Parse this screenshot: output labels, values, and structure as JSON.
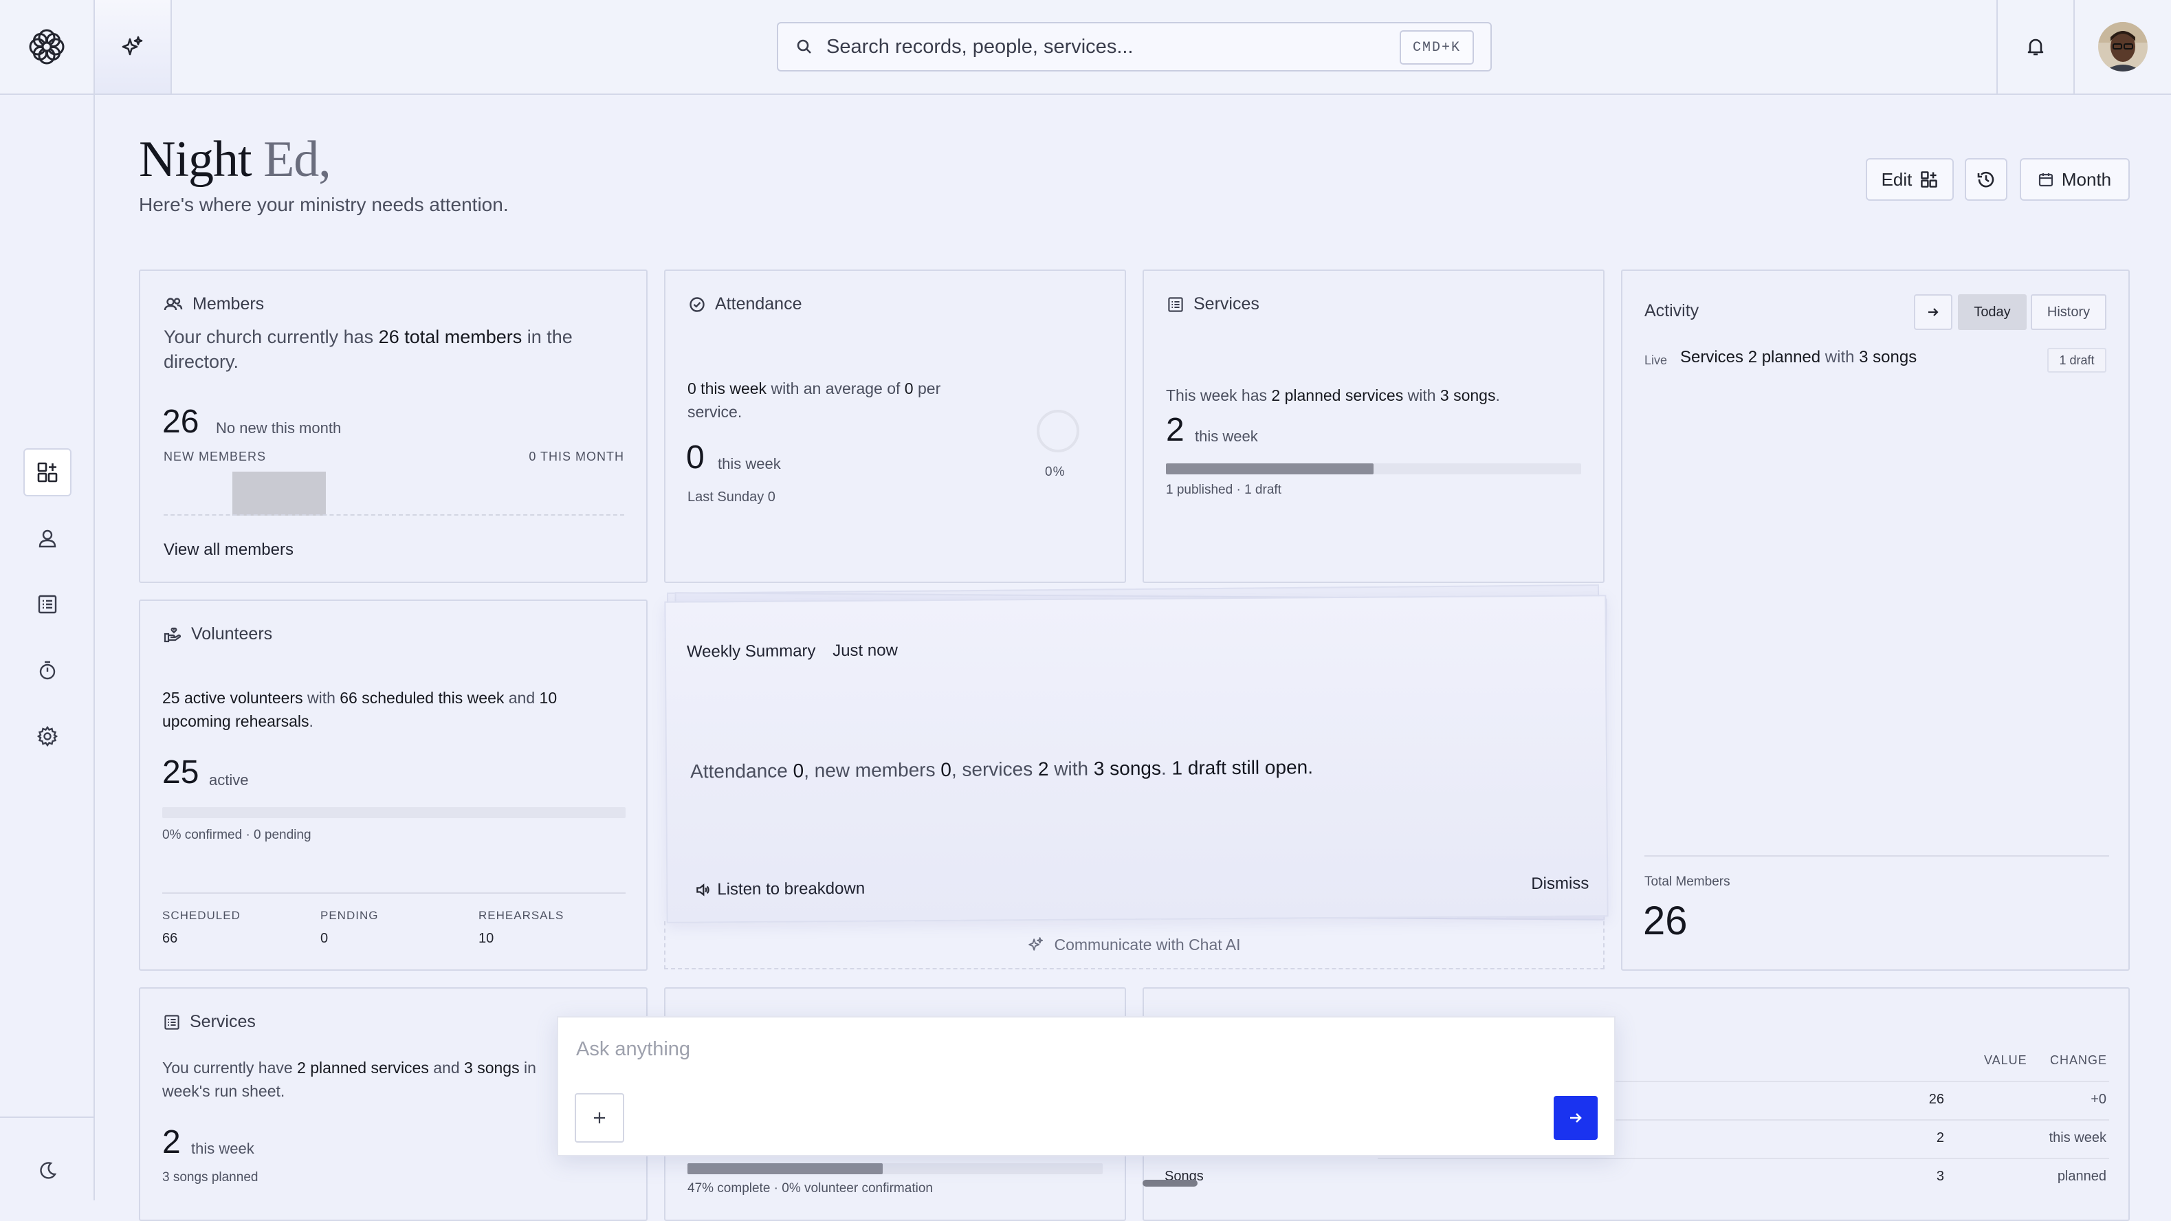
{
  "search": {
    "placeholder": "Search records, people, services...",
    "shortcut": "CMD+K"
  },
  "greeting": {
    "word": "Night",
    "name": "Ed,",
    "subtitle": "Here's where your ministry needs attention."
  },
  "toolbar": {
    "edit_label": "Edit",
    "month_label": "Month"
  },
  "members_card": {
    "title": "Members",
    "desc_1": "Your church currently has ",
    "desc_bold": "26 total members",
    "desc_2": " in the directory.",
    "count": "26",
    "note": "No new this month",
    "label_left": "NEW MEMBERS",
    "label_right": "0 THIS MONTH",
    "link": "View all members"
  },
  "attendance_card": {
    "title": "Attendance",
    "desc_b1": "0 this week",
    "desc_mid": " with an average of ",
    "desc_b2": "0",
    "desc_end": " per service.",
    "count": "0",
    "unit": "this week",
    "last": "Last Sunday 0",
    "percent": "0%"
  },
  "services_card": {
    "title": "Services",
    "desc_1": "This week has ",
    "desc_b1": "2 planned services",
    "desc_2": " with ",
    "desc_b2": "3 songs",
    "desc_3": ".",
    "count": "2",
    "unit": "this week",
    "progress": 0.5,
    "meta": "1 published · 1 draft"
  },
  "activity_card": {
    "title": "Activity",
    "tab_today": "Today",
    "tab_history": "History",
    "live_label": "Live",
    "item_b1": "Services 2 planned",
    "item_mid": " with ",
    "item_b2": "3 songs",
    "item_badge": "1 draft",
    "total_label": "Total Members",
    "total_value": "26"
  },
  "volunteers_card": {
    "title": "Volunteers",
    "desc_b1": "25 active volunteers",
    "desc_2": " with ",
    "desc_b2": "66 scheduled this week",
    "desc_3": " and ",
    "desc_b3": "10",
    "desc_b4": "upcoming rehearsals",
    "desc_4": ".",
    "count": "25",
    "unit": "active",
    "meta": "0% confirmed · 0 pending",
    "stats": [
      {
        "label": "SCHEDULED",
        "value": "66"
      },
      {
        "label": "PENDING",
        "value": "0"
      },
      {
        "label": "REHEARSALS",
        "value": "10"
      }
    ]
  },
  "weekly_summary": {
    "title": "Weekly Summary",
    "time": "Just now",
    "t1": "Attendance ",
    "b1": "0",
    "t2": ", new members ",
    "b2": "0",
    "t3": ", services ",
    "b3": "2",
    "t4": " with ",
    "b4": "3 songs",
    "t5": ". ",
    "b5": "1 draft still open.",
    "listen": "Listen to breakdown",
    "dismiss": "Dismiss",
    "chat_ai": "Communicate with Chat AI"
  },
  "services_card2": {
    "title": "Services",
    "desc_1": "You currently have ",
    "desc_b1": "2 planned services",
    "desc_2": " and ",
    "desc_b2": "3 songs",
    "desc_3": " in",
    "desc_4": "week's run sheet.",
    "count": "2",
    "unit": "this week",
    "meta": "3 songs planned"
  },
  "bottom_middle_card": {
    "progress": 0.47,
    "meta": "47% complete · 0% volunteer confirmation"
  },
  "stats_table": {
    "col_value": "VALUE",
    "col_change": "CHANGE",
    "rows": [
      {
        "label": "",
        "value": "26",
        "change": "+0"
      },
      {
        "label": "",
        "value": "2",
        "change": "this week"
      },
      {
        "label": "Songs",
        "value": "3",
        "change": "planned"
      }
    ]
  },
  "ask": {
    "placeholder": "Ask anything"
  },
  "icons": {
    "logo": "flower-logo-icon",
    "spark": "sparkle-icon",
    "bell": "bell-icon",
    "sidebar": [
      "dashboard-icon",
      "person-icon",
      "list-icon",
      "timer-icon",
      "gear-icon",
      "moon-icon"
    ]
  },
  "colors": {
    "accent": "#1a33f0",
    "background": "#eff1fb",
    "progress_fill": "#8a8c98"
  }
}
